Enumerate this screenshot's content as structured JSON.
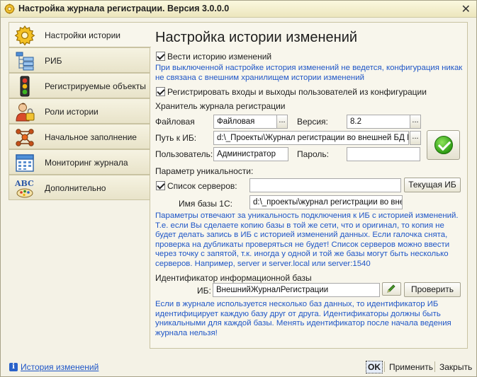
{
  "window": {
    "title": "Настройка журнала регистрации. Версия 3.0.0.0",
    "close_glyph": "✕"
  },
  "nav": {
    "items": [
      {
        "label": "Настройки истории",
        "icon": "gear-icon",
        "active": true
      },
      {
        "label": "РИБ",
        "icon": "tree-icon",
        "active": false
      },
      {
        "label": "Регистрируемые объекты",
        "icon": "traffic-light-icon",
        "active": false
      },
      {
        "label": "Роли истории",
        "icon": "user-lock-icon",
        "active": false
      },
      {
        "label": "Начальное заполнение",
        "icon": "molecule-icon",
        "active": false
      },
      {
        "label": "Мониторинг журнала",
        "icon": "calendar-icon",
        "active": false
      },
      {
        "label": "Дополнительно",
        "icon": "abc-icon",
        "active": false
      }
    ]
  },
  "main": {
    "title": "Настройка истории изменений",
    "keep_history": {
      "label": "Вести историю изменений",
      "checked": true
    },
    "keep_history_note": "При выключенной настройке история изменений не ведется, конфигурация никак не связана с внешним хранилищем истории изменений",
    "log_sessions": {
      "label": "Регистрировать входы и выходы пользователей из конфигурации",
      "checked": true
    },
    "storage_header": "Хранитель журнала регистрации",
    "file_label": "Файловая",
    "file_value": "Файловая",
    "version_label": "Версия:",
    "version_value": "8.2",
    "path_label": "Путь к ИБ:",
    "path_value": "d:\\_Проекты\\Журнал регистрации во внешней БД МЗ",
    "user_label": "Пользователь:",
    "user_value": "Администратор",
    "password_label": "Пароль:",
    "password_value": "",
    "dots_label": "...",
    "uniqueness_header": "Параметр уникальности:",
    "server_list": {
      "label": "Список серверов:",
      "checked": true
    },
    "server_list_value": "",
    "current_ib_button": "Текущая ИБ",
    "db_name_label": "Имя базы 1С:",
    "db_name_value": "d:\\_проекты\\журнал регистрации во внешней",
    "uniqueness_note": "Параметры отвечают за уникальность подключения к ИБ с историей изменений. Т.е. если Вы сделаете копию базы в той же сети, что и оригинал, то копия не будет делать запись в ИБ с историей изменений данных. Если галочка снята, проверка на дубликаты проверяться не будет! Список серверов можно ввести через точку с запятой, т.к. иногда у одной и той же базы могут быть несколько серверов. Например, server и server.local или server:1540",
    "ib_id_header": "Идентификатор информационной базы",
    "ib_label": "ИБ:",
    "ib_value": "ВнешнийЖурналРегистрации",
    "check_button": "Проверить",
    "ib_note": "Если в журнале используется несколько баз данных, то идентификатор ИБ идентифицирует каждую базу друг от друга. Идентификаторы должны быть уникальными для каждой базы. Менять идентификатор после начала ведения журнала нельзя!"
  },
  "footer": {
    "history_link": "История изменений",
    "ok_button": "OK",
    "apply_button": "Применить",
    "close_button": "Закрыть"
  },
  "colors": {
    "note_blue": "#1f56c7",
    "ok_green": "#2e9d14"
  }
}
